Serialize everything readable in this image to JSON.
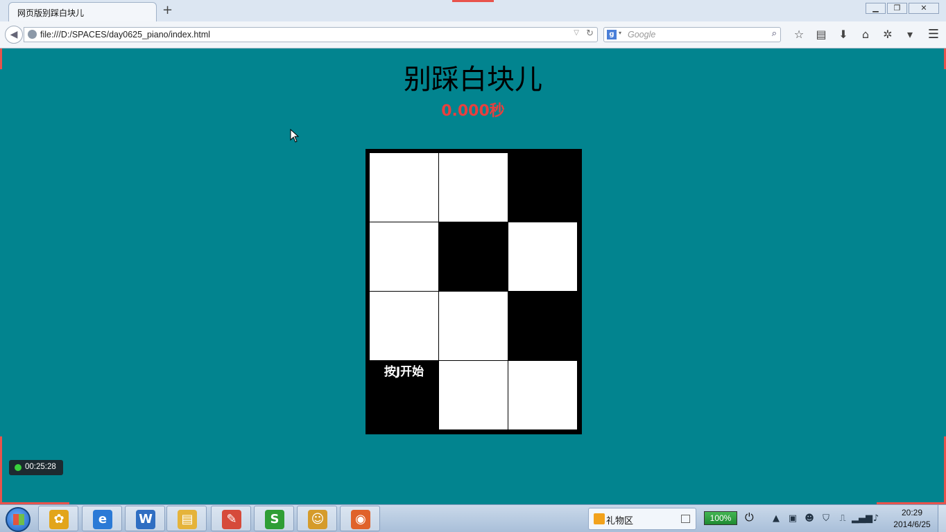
{
  "browser": {
    "tab_title": "网页版别踩白块儿",
    "new_tab": "+",
    "url": "file:///D:/SPACES/day0625_piano/index.html",
    "search_placeholder": "Google",
    "search_engine_icon": "g",
    "window_controls": [
      "minimize",
      "restore",
      "close"
    ],
    "toolbar_icons": [
      "star-icon",
      "reading-list-icon",
      "download-icon",
      "home-icon",
      "addon-icon",
      "menu-icon"
    ]
  },
  "game": {
    "title": "别踩白块儿",
    "timer": "0.000秒",
    "start_hint": "按J开始",
    "columns": 3,
    "rows": [
      [
        "white",
        "white",
        "black"
      ],
      [
        "white",
        "black",
        "white"
      ],
      [
        "white",
        "white",
        "black"
      ],
      [
        "black",
        "white",
        "white"
      ]
    ],
    "hint_row": 3,
    "hint_col": 0
  },
  "recorder": {
    "elapsed": "00:25:28"
  },
  "taskbar": {
    "apps": [
      {
        "name": "app-pinwheel",
        "glyph": "✿",
        "color": "#e2a51b"
      },
      {
        "name": "app-ie",
        "glyph": "e",
        "color": "#2b7ad6"
      },
      {
        "name": "app-wps",
        "glyph": "W",
        "color": "#2f6ec2"
      },
      {
        "name": "app-explorer",
        "glyph": "▤",
        "color": "#e5b33a"
      },
      {
        "name": "app-notes",
        "glyph": "✎",
        "color": "#d64a3a"
      },
      {
        "name": "app-s",
        "glyph": "S",
        "color": "#2f9e35"
      },
      {
        "name": "app-thunder",
        "glyph": "☺",
        "color": "#d59b2a"
      },
      {
        "name": "app-firefox",
        "glyph": "◉",
        "color": "#e0622a"
      }
    ],
    "gift_label": "礼物区",
    "battery": "100%",
    "time": "20:29",
    "date": "2014/6/25"
  }
}
